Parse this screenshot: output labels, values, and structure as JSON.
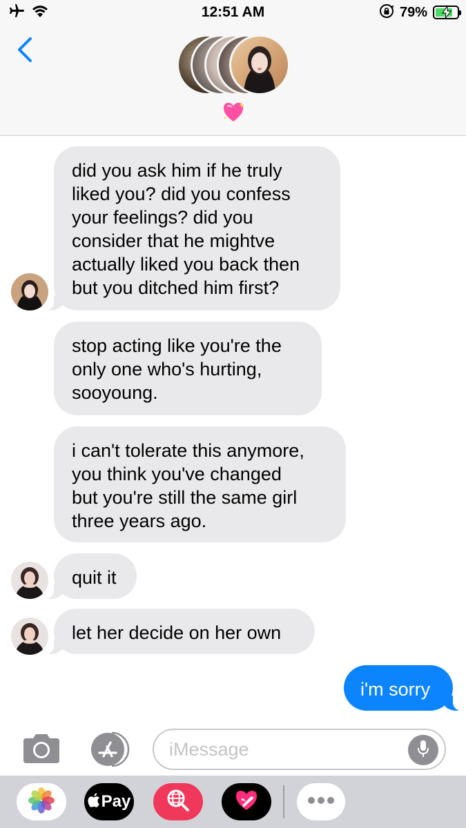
{
  "status_bar": {
    "time": "12:51 AM",
    "battery_percent": "79%",
    "battery_level": 0.79,
    "icons": [
      "airplane-icon",
      "wifi-icon",
      "orientation-lock-icon",
      "battery-charging-icon"
    ]
  },
  "header": {
    "group_emoji": "💖",
    "icons": [
      "back-chevron-icon"
    ]
  },
  "messages": [
    {
      "direction": "received",
      "text": "did you ask him if he truly\nliked you? did you confess\nyour feelings? did you\nconsider that he mightve\nactually liked you back then\nbut you ditched him first?"
    },
    {
      "direction": "received",
      "text": "stop acting like you're the\nonly one who's hurting,\nsooyoung."
    },
    {
      "direction": "received",
      "text": "i can't tolerate this anymore,\nyou think you've changed\nbut you're still the same girl\nthree years ago."
    },
    {
      "direction": "received",
      "text": "quit it"
    },
    {
      "direction": "received",
      "text": "let her decide on her own"
    },
    {
      "direction": "sent",
      "text": "i'm sorry"
    }
  ],
  "input_bar": {
    "placeholder": "iMessage",
    "icons": [
      "camera-icon",
      "app-store-icon",
      "microphone-icon"
    ]
  },
  "app_drawer": {
    "apple_pay_label": "Pay",
    "icons": [
      "photos-icon",
      "apple-pay-icon",
      "web-search-icon",
      "digital-touch-icon",
      "more-icon"
    ]
  },
  "colors": {
    "accent_blue": "#0b84fe",
    "received_bubble": "#e9e9eb",
    "battery_green": "#4cd964",
    "search_app_red": "#f0385b"
  }
}
